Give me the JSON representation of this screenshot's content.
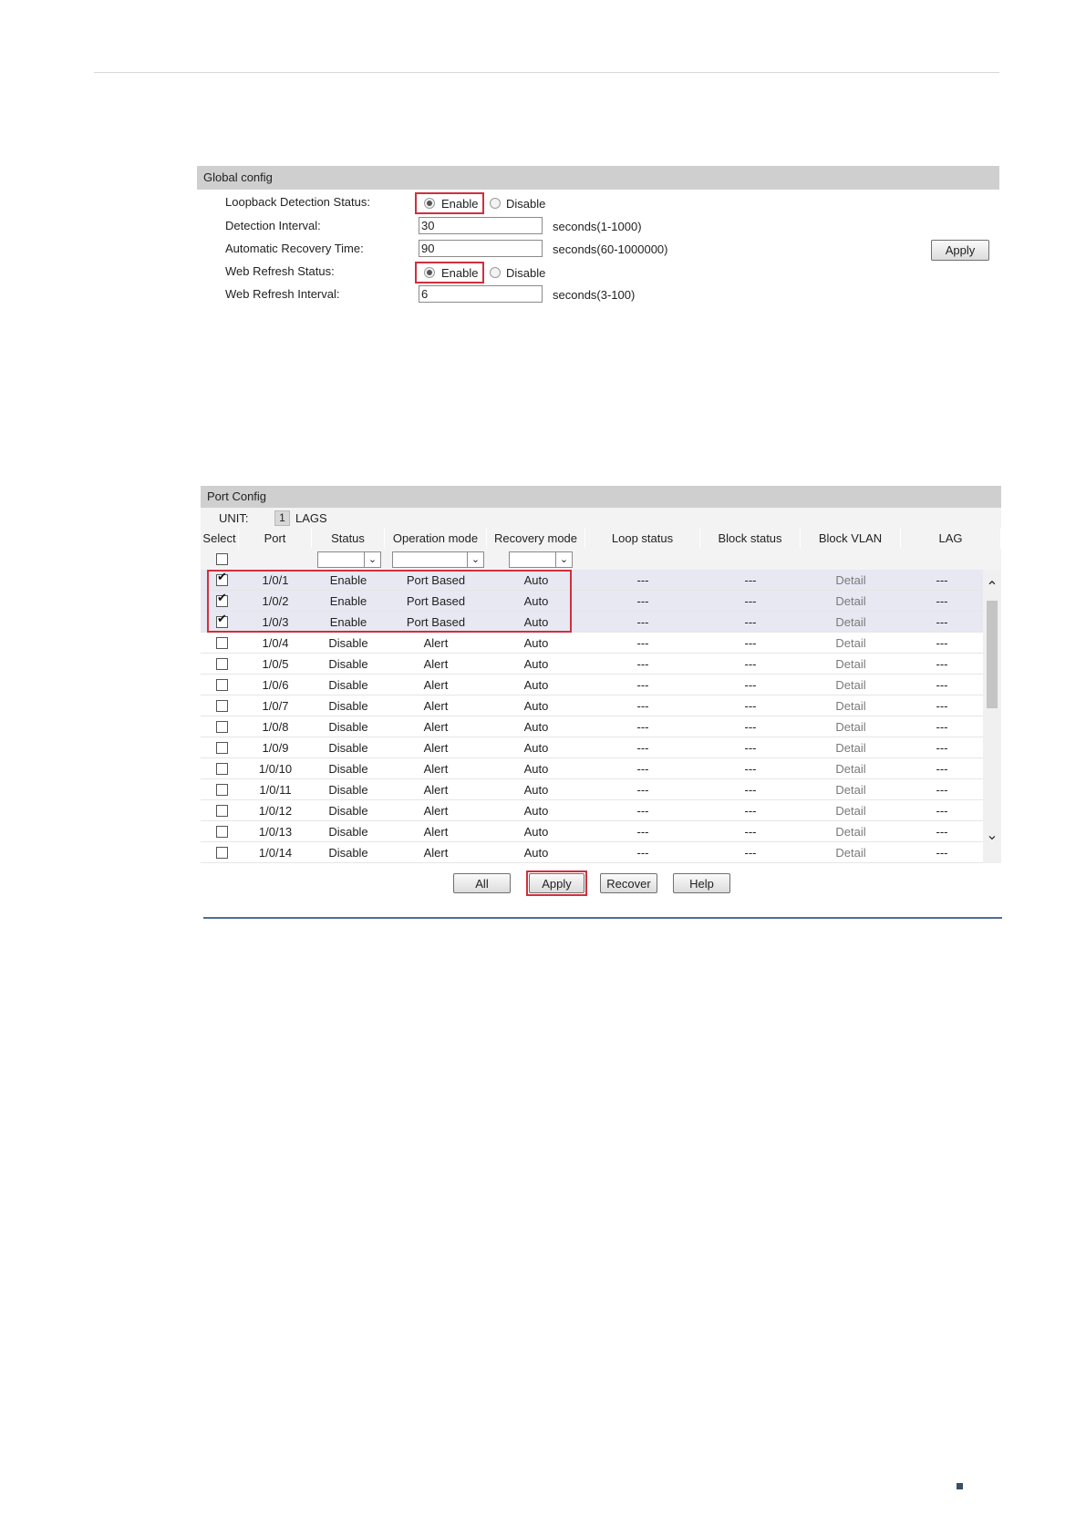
{
  "global_config": {
    "title": "Global config",
    "loopback_label": "Loopback Detection Status:",
    "loopback_enable": "Enable",
    "loopback_disable": "Disable",
    "detection_interval_label": "Detection Interval:",
    "detection_interval_value": "30",
    "detection_interval_unit": "seconds(1-1000)",
    "recovery_time_label": "Automatic Recovery Time:",
    "recovery_time_value": "90",
    "recovery_time_unit": "seconds(60-1000000)",
    "web_refresh_status_label": "Web Refresh Status:",
    "web_refresh_enable": "Enable",
    "web_refresh_disable": "Disable",
    "web_refresh_interval_label": "Web Refresh Interval:",
    "web_refresh_interval_value": "6",
    "web_refresh_interval_unit": "seconds(3-100)",
    "apply_label": "Apply"
  },
  "port_config": {
    "title": "Port Config",
    "unit_label": "UNIT:",
    "unit_value": "1",
    "lags_label": "LAGS",
    "columns": [
      "Select",
      "Port",
      "Status",
      "Operation mode",
      "Recovery mode",
      "Loop status",
      "Block status",
      "Block VLAN",
      "LAG"
    ],
    "rows": [
      {
        "checked": true,
        "port": "1/0/1",
        "status": "Enable",
        "operation": "Port Based",
        "recovery": "Auto",
        "loop": "---",
        "block": "---",
        "vlan": "Detail",
        "lag": "---"
      },
      {
        "checked": true,
        "port": "1/0/2",
        "status": "Enable",
        "operation": "Port Based",
        "recovery": "Auto",
        "loop": "---",
        "block": "---",
        "vlan": "Detail",
        "lag": "---"
      },
      {
        "checked": true,
        "port": "1/0/3",
        "status": "Enable",
        "operation": "Port Based",
        "recovery": "Auto",
        "loop": "---",
        "block": "---",
        "vlan": "Detail",
        "lag": "---"
      },
      {
        "checked": false,
        "port": "1/0/4",
        "status": "Disable",
        "operation": "Alert",
        "recovery": "Auto",
        "loop": "---",
        "block": "---",
        "vlan": "Detail",
        "lag": "---"
      },
      {
        "checked": false,
        "port": "1/0/5",
        "status": "Disable",
        "operation": "Alert",
        "recovery": "Auto",
        "loop": "---",
        "block": "---",
        "vlan": "Detail",
        "lag": "---"
      },
      {
        "checked": false,
        "port": "1/0/6",
        "status": "Disable",
        "operation": "Alert",
        "recovery": "Auto",
        "loop": "---",
        "block": "---",
        "vlan": "Detail",
        "lag": "---"
      },
      {
        "checked": false,
        "port": "1/0/7",
        "status": "Disable",
        "operation": "Alert",
        "recovery": "Auto",
        "loop": "---",
        "block": "---",
        "vlan": "Detail",
        "lag": "---"
      },
      {
        "checked": false,
        "port": "1/0/8",
        "status": "Disable",
        "operation": "Alert",
        "recovery": "Auto",
        "loop": "---",
        "block": "---",
        "vlan": "Detail",
        "lag": "---"
      },
      {
        "checked": false,
        "port": "1/0/9",
        "status": "Disable",
        "operation": "Alert",
        "recovery": "Auto",
        "loop": "---",
        "block": "---",
        "vlan": "Detail",
        "lag": "---"
      },
      {
        "checked": false,
        "port": "1/0/10",
        "status": "Disable",
        "operation": "Alert",
        "recovery": "Auto",
        "loop": "---",
        "block": "---",
        "vlan": "Detail",
        "lag": "---"
      },
      {
        "checked": false,
        "port": "1/0/11",
        "status": "Disable",
        "operation": "Alert",
        "recovery": "Auto",
        "loop": "---",
        "block": "---",
        "vlan": "Detail",
        "lag": "---"
      },
      {
        "checked": false,
        "port": "1/0/12",
        "status": "Disable",
        "operation": "Alert",
        "recovery": "Auto",
        "loop": "---",
        "block": "---",
        "vlan": "Detail",
        "lag": "---"
      },
      {
        "checked": false,
        "port": "1/0/13",
        "status": "Disable",
        "operation": "Alert",
        "recovery": "Auto",
        "loop": "---",
        "block": "---",
        "vlan": "Detail",
        "lag": "---"
      },
      {
        "checked": false,
        "port": "1/0/14",
        "status": "Disable",
        "operation": "Alert",
        "recovery": "Auto",
        "loop": "---",
        "block": "---",
        "vlan": "Detail",
        "lag": "---"
      }
    ],
    "buttons": {
      "all": "All",
      "apply": "Apply",
      "recover": "Recover",
      "help": "Help"
    }
  },
  "colors": {
    "highlight": "#d0303c",
    "header_bg": "#cfcfcf",
    "selected_row_bg": "#e7e8f2",
    "rule": "#4f6e95"
  }
}
